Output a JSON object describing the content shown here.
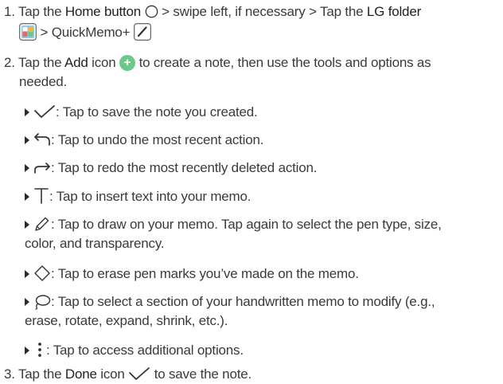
{
  "step1": {
    "num": "1.",
    "text_a": "Tap the ",
    "home_bold": "Home button",
    "text_b": " > swipe left, if necessary > Tap the ",
    "lg_bold": "LG folder",
    "text_c": " > QuickMemo+ "
  },
  "step2": {
    "num": "2.",
    "text_a": "Tap the ",
    "add_bold": "Add",
    "text_b": " icon ",
    "text_c": " to create a note, then use the tools and options as",
    "text_d": "needed."
  },
  "items": {
    "save": ": Tap to save the note you created.",
    "undo": ": Tap to undo the most recent action.",
    "redo": ": Tap to redo the most recently deleted action.",
    "text": ": Tap to insert text into your memo.",
    "draw_a": ": Tap to draw on your memo. Tap again to select the pen type, size,",
    "draw_b": "color, and transparency.",
    "erase": ": Tap to erase pen marks you’ve made on the memo.",
    "lasso_a": ": Tap to select a section of your handwritten memo to modify (e.g.,",
    "lasso_b": "erase, rotate, expand, shrink, etc.).",
    "more": ": Tap to access additional options."
  },
  "step3": {
    "num": "3.",
    "text_a": "Tap the ",
    "done_bold": "Done",
    "text_b": " icon ",
    "text_c": " to save the note."
  },
  "icons": {
    "home": "home-circle-icon",
    "lg_folder": "lg-folder-icon",
    "quickmemo": "quickmemo-pen-icon",
    "add": "plus",
    "add_color": "#6cc98a"
  }
}
